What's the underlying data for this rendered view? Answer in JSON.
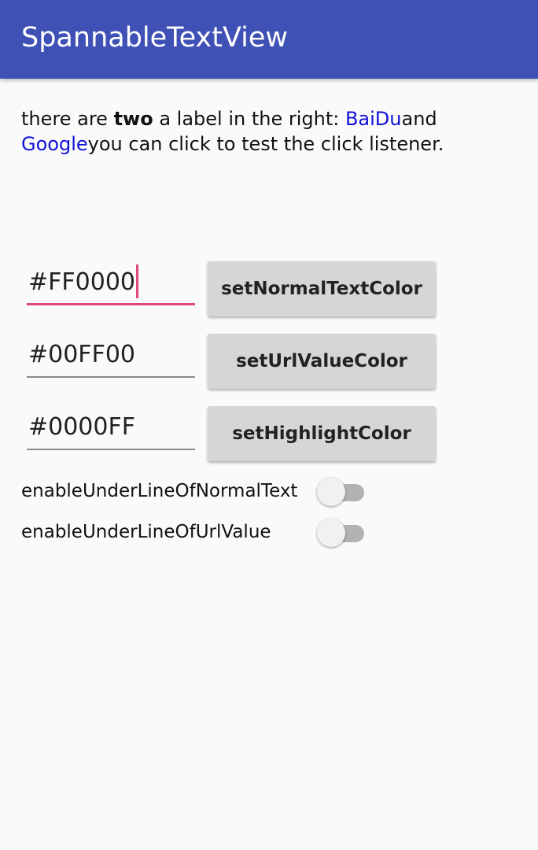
{
  "app": {
    "title": "SpannableTextView"
  },
  "span_text": {
    "part1": "there are ",
    "bold": "two",
    "part2": " a label in the right: ",
    "link1": "BaiDu",
    "part3": "and ",
    "link2": "Google",
    "part4": "you can click to test the click listener."
  },
  "controls": {
    "normal": {
      "value": "#FF0000",
      "button_label": "setNormalTextColor"
    },
    "url": {
      "value": "#00FF00",
      "button_label": "setUrlValueColor"
    },
    "highlight": {
      "value": "#0000FF",
      "button_label": "setHighlightColor"
    }
  },
  "switches": {
    "normal_underline": {
      "label": "enableUnderLineOfNormalText",
      "checked": false
    },
    "url_underline": {
      "label": "enableUnderLineOfUrlValue",
      "checked": false
    }
  },
  "colors": {
    "primary": "#3f51b5",
    "accent": "#e0457b",
    "link": "#1010d8",
    "background": "#fafafa"
  }
}
